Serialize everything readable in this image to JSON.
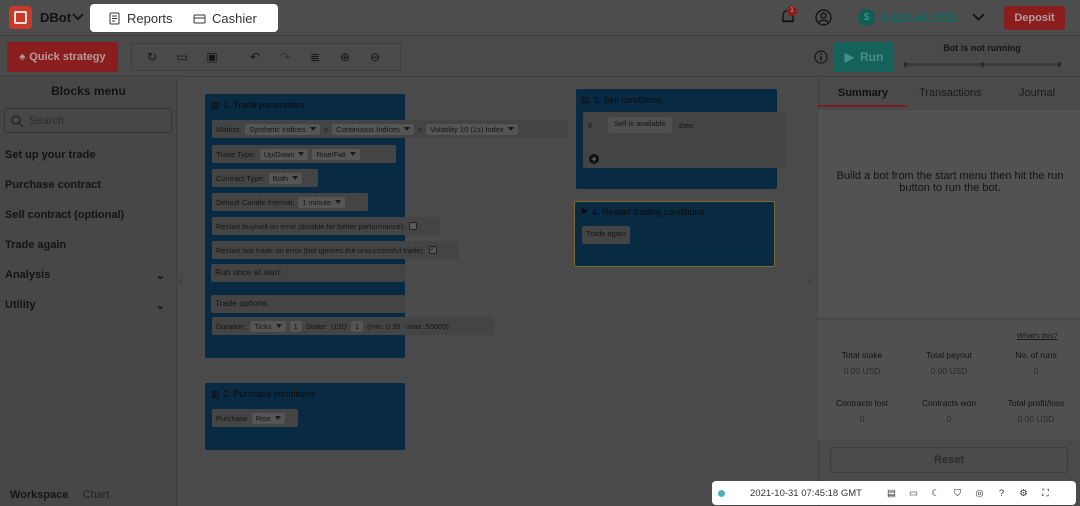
{
  "app": {
    "name": "DBot"
  },
  "nav": {
    "reports": "Reports",
    "cashier": "Cashier"
  },
  "account": {
    "notifications": "1",
    "balance": "9,629.46 USD",
    "deposit": "Deposit"
  },
  "toolbar": {
    "quick_strategy": "Quick strategy",
    "run": "Run",
    "status": "Bot is not running"
  },
  "sidebar": {
    "title": "Blocks menu",
    "search_placeholder": "Search",
    "items": [
      "Set up your trade",
      "Purchase contract",
      "Sell contract (optional)",
      "Trade again",
      "Analysis",
      "Utility"
    ]
  },
  "footer_tabs": {
    "workspace": "Workspace",
    "chart": "Chart"
  },
  "blocks": {
    "trade": {
      "title": "1. Trade parameters",
      "market_label": "Market:",
      "market": [
        "Synthetic Indices",
        "Continuous Indices",
        "Volatility 10 (1s) Index"
      ],
      "trade_type_label": "Trade Type:",
      "trade_type": [
        "Up/Down",
        "Rise/Fall"
      ],
      "contract_type_label": "Contract Type:",
      "contract_type": "Both",
      "candle_label": "Default Candle Interval:",
      "candle": "1 minute",
      "restart_buy_sell": "Restart buy/sell on error (disable for better performance):",
      "restart_last_trade": "Restart last trade on error (bot ignores the unsuccessful trade):",
      "run_once": "Run once at start:",
      "trade_options": "Trade options:",
      "duration_label": "Duration:",
      "duration_unit": "Ticks",
      "duration_value": "1",
      "stake_label": "Stake:",
      "currency": "USD",
      "stake_value": "1",
      "stake_range": "(min: 0.35 - max: 50000)"
    },
    "purchase": {
      "title": "2. Purchase conditions",
      "label": "Purchase",
      "value": "Rise"
    },
    "sell": {
      "title": "3. Sell conditions",
      "if": "if",
      "condition": "Sell is available",
      "then": "then"
    },
    "restart": {
      "title": "4. Restart trading conditions",
      "value": "Trade again"
    }
  },
  "summary": {
    "tabs": [
      "Summary",
      "Transactions",
      "Journal"
    ],
    "message": "Build a bot from the start menu then hit the run button to run the bot.",
    "whats_this": "What's this?",
    "stats": [
      {
        "label": "Total stake",
        "value": "0.00 USD"
      },
      {
        "label": "Total payout",
        "value": "0.00 USD"
      },
      {
        "label": "No. of runs",
        "value": "0"
      },
      {
        "label": "Contracts lost",
        "value": "0"
      },
      {
        "label": "Contracts won",
        "value": "0"
      },
      {
        "label": "Total profit/loss",
        "value": "0.00 USD"
      }
    ],
    "reset": "Reset"
  },
  "bottom_bar": {
    "timestamp": "2021-10-31 07:45:18 GMT"
  }
}
